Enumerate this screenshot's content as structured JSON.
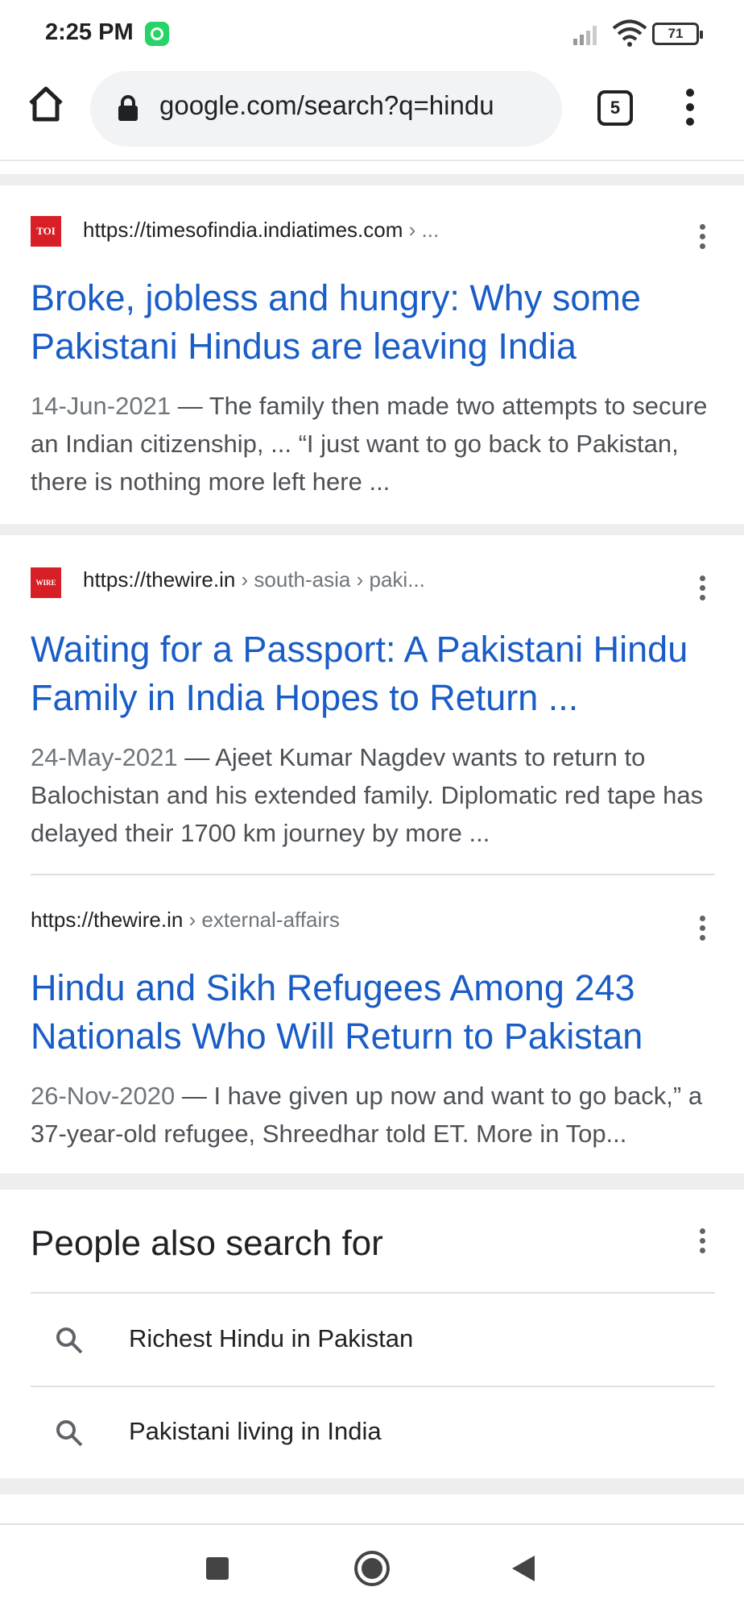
{
  "status_bar": {
    "time": "2:25 PM",
    "battery": "71"
  },
  "toolbar": {
    "url": "google.com/search?q=hindu",
    "tab_count": "5"
  },
  "results": [
    {
      "favicon_text": "TOI",
      "favicon_color": "#d81f26",
      "site": "https://timesofindia.indiatimes.com",
      "crumb": " › ...",
      "title": "Broke, jobless and hungry: Why some Pakistani Hindus are leaving India",
      "date": "14-Jun-2021",
      "snippet": " — The family then made two attempts to secure an Indian citizenship, ... “I just want to go back to Pakistan, there is nothing more left here ..."
    },
    {
      "favicon_text": "WIRE",
      "favicon_color": "#d81f26",
      "site": "https://thewire.in",
      "crumb": " › south-asia › paki...",
      "title": "Waiting for a Passport: A Pakistani Hindu Family in India Hopes to Return ...",
      "date": "24-May-2021",
      "snippet": " — Ajeet Kumar Nagdev wants to return to Balochistan and his extended family. Diplomatic red tape has delayed their 1700 km journey by more ..."
    },
    {
      "site": "https://thewire.in",
      "crumb": " › external-affairs",
      "title": "Hindu and Sikh Refugees Among 243 Nationals Who Will Return to Pakistan",
      "date": "26-Nov-2020",
      "snippet": " — I have given up now and want to go back,” a 37-year-old refugee, Shreedhar told ET. More in Top..."
    }
  ],
  "people_also_search": {
    "heading": "People also search for",
    "items": [
      "Richest Hindu in Pakistan",
      "Pakistani living in India"
    ]
  },
  "colors": {
    "link": "#1a5dc7",
    "whatsapp": "#25D366"
  }
}
